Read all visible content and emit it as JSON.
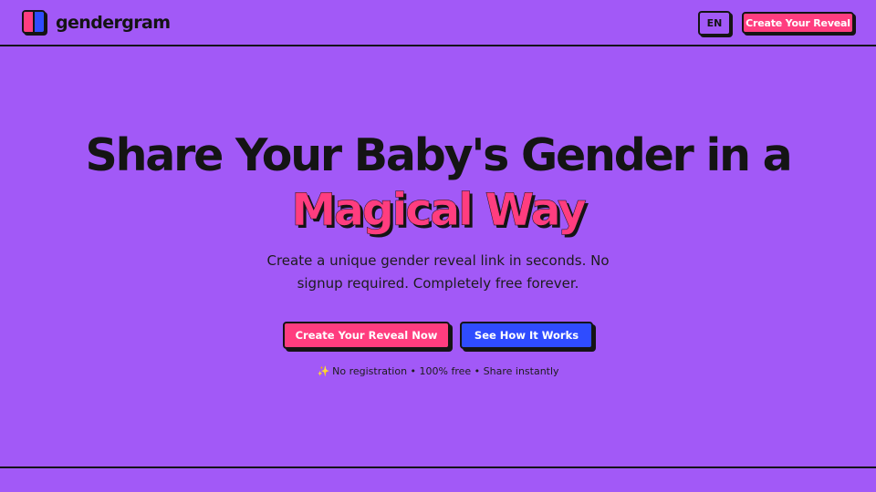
{
  "brand": {
    "name": "gendergram",
    "logo_icon": "split-square-logo-icon"
  },
  "nav": {
    "language": "EN",
    "cta_label": "Create Your Reveal"
  },
  "hero": {
    "title_line1": "Share Your Baby's Gender in a",
    "title_highlight": "Magical Way",
    "subtitle": "Create a unique gender reveal link in seconds. No signup required. Completely free forever.",
    "primary_button": "Create Your Reveal Now",
    "secondary_button": "See How It Works",
    "note_icon": "sparkles-icon",
    "note_icon_glyph": "✨",
    "note_text": "No registration • 100% free • Share instantly"
  },
  "colors": {
    "background": "#a259f7",
    "pink": "#ff3d7f",
    "blue": "#2f4cff",
    "ink": "#141414"
  }
}
